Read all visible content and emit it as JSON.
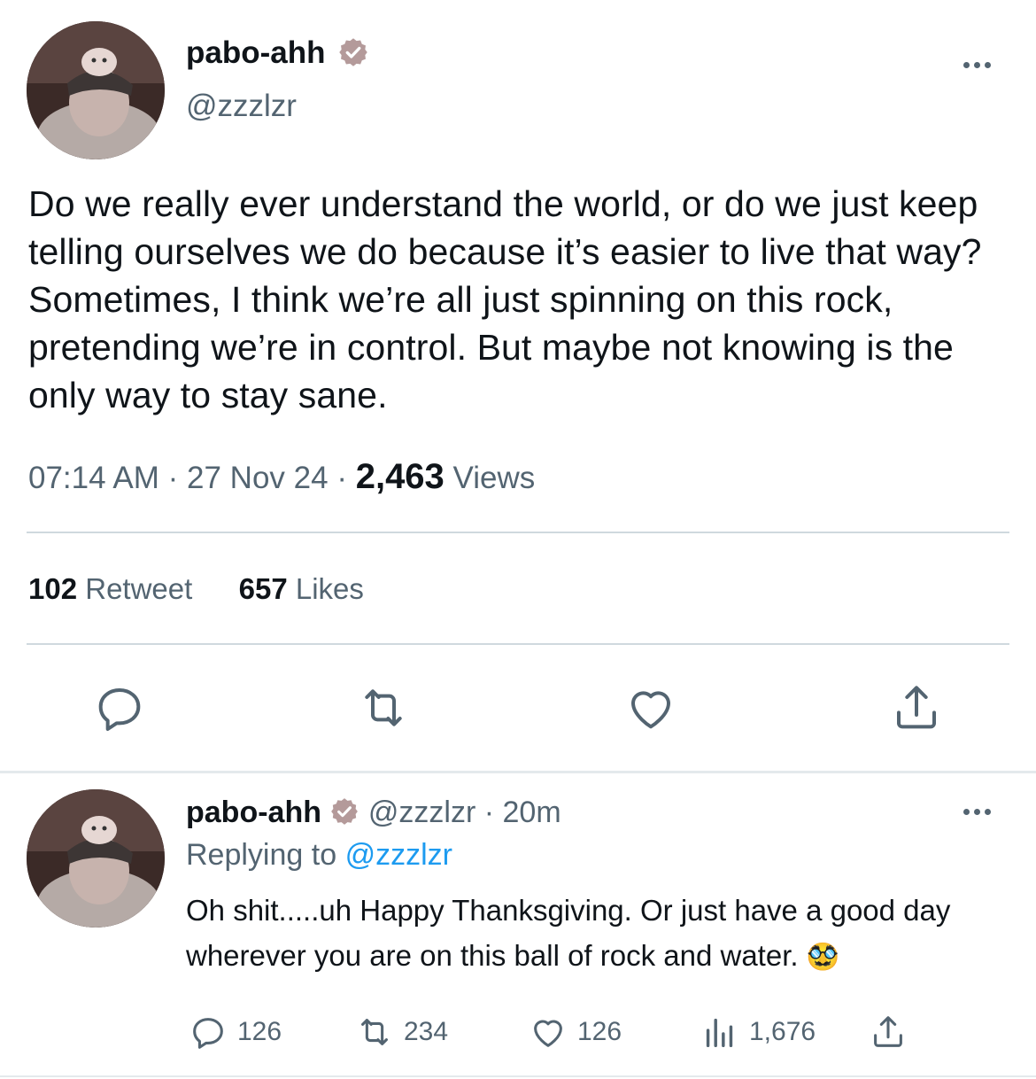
{
  "main_tweet": {
    "author_name": "pabo-ahh",
    "author_handle": "@zzzlzr",
    "text": "Do we really ever understand the world, or do we just keep telling ourselves we do because it’s easier to live that way? Sometimes, I think we’re all just spinning on this rock, pretending we’re in control. But maybe not knowing is the only way to stay sane.",
    "time": "07:14 AM",
    "date": "27 Nov 24",
    "separator": "·",
    "views_count": "2,463",
    "views_label": "Views",
    "retweet_count": "102",
    "retweet_label": "Retweet",
    "likes_count": "657",
    "likes_label": "Likes",
    "actions": [
      "reply-icon",
      "retweet-icon",
      "like-icon",
      "share-icon"
    ]
  },
  "reply_tweet": {
    "author_name": "pabo-ahh",
    "author_handle": "@zzzlzr",
    "time_ago": "20m",
    "replying_to_label": "Replying to",
    "replying_to_handle": "@zzzlzr",
    "text": "Oh shit.....uh Happy Thanksgiving. Or just have a good day wherever you are on this ball of rock and water.",
    "emoji": "🥸",
    "reply_count": "126",
    "retweet_count": "234",
    "like_count": "126",
    "view_count": "1,676"
  },
  "colors": {
    "text_primary": "#0f1419",
    "text_secondary": "#536471",
    "link": "#1d9bf0",
    "divider": "#cfd9de",
    "verified_badge": "#b49a9a"
  }
}
